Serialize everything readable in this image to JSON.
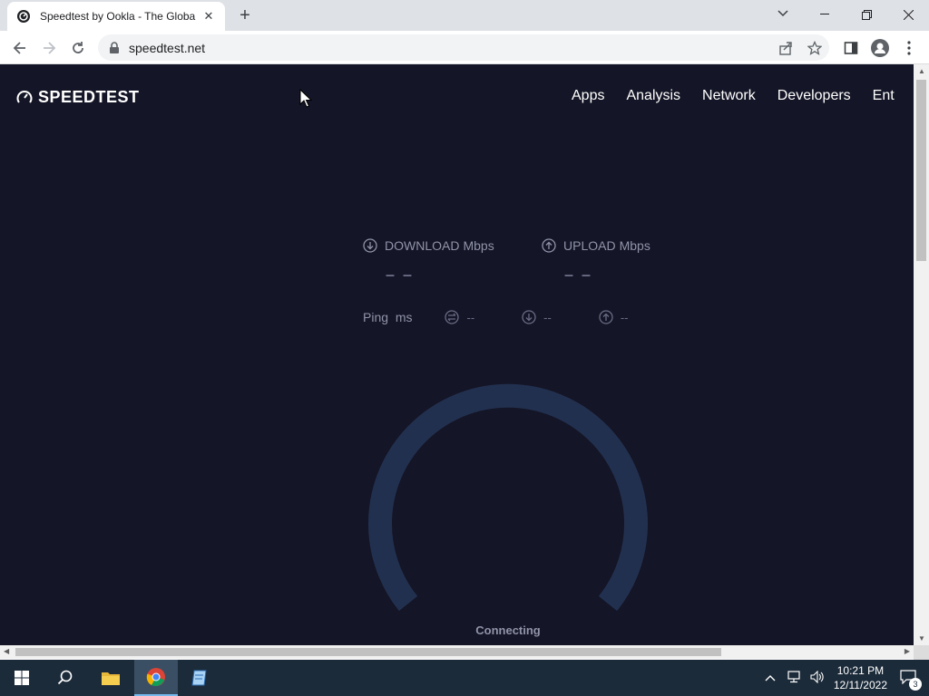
{
  "browser": {
    "tab_title": "Speedtest by Ookla - The Global",
    "url": "speedtest.net"
  },
  "site": {
    "logo_text": "SPEEDTEST",
    "nav": [
      "Apps",
      "Analysis",
      "Network",
      "Developers",
      "Ent"
    ]
  },
  "metrics": {
    "download_label": "DOWNLOAD",
    "download_unit": "Mbps",
    "download_value": "– –",
    "upload_label": "UPLOAD",
    "upload_unit": "Mbps",
    "upload_value": "– –",
    "ping_label": "Ping",
    "ping_unit": "ms",
    "jitter_value": "--",
    "ping_down_value": "--",
    "ping_up_value": "--"
  },
  "gauge": {
    "status": "Connecting",
    "color": "#22304f"
  },
  "taskbar": {
    "time": "10:21 PM",
    "date": "12/11/2022",
    "notifications": "3"
  },
  "colors": {
    "page_bg": "#141526",
    "taskbar_bg": "#1c2b3a"
  }
}
